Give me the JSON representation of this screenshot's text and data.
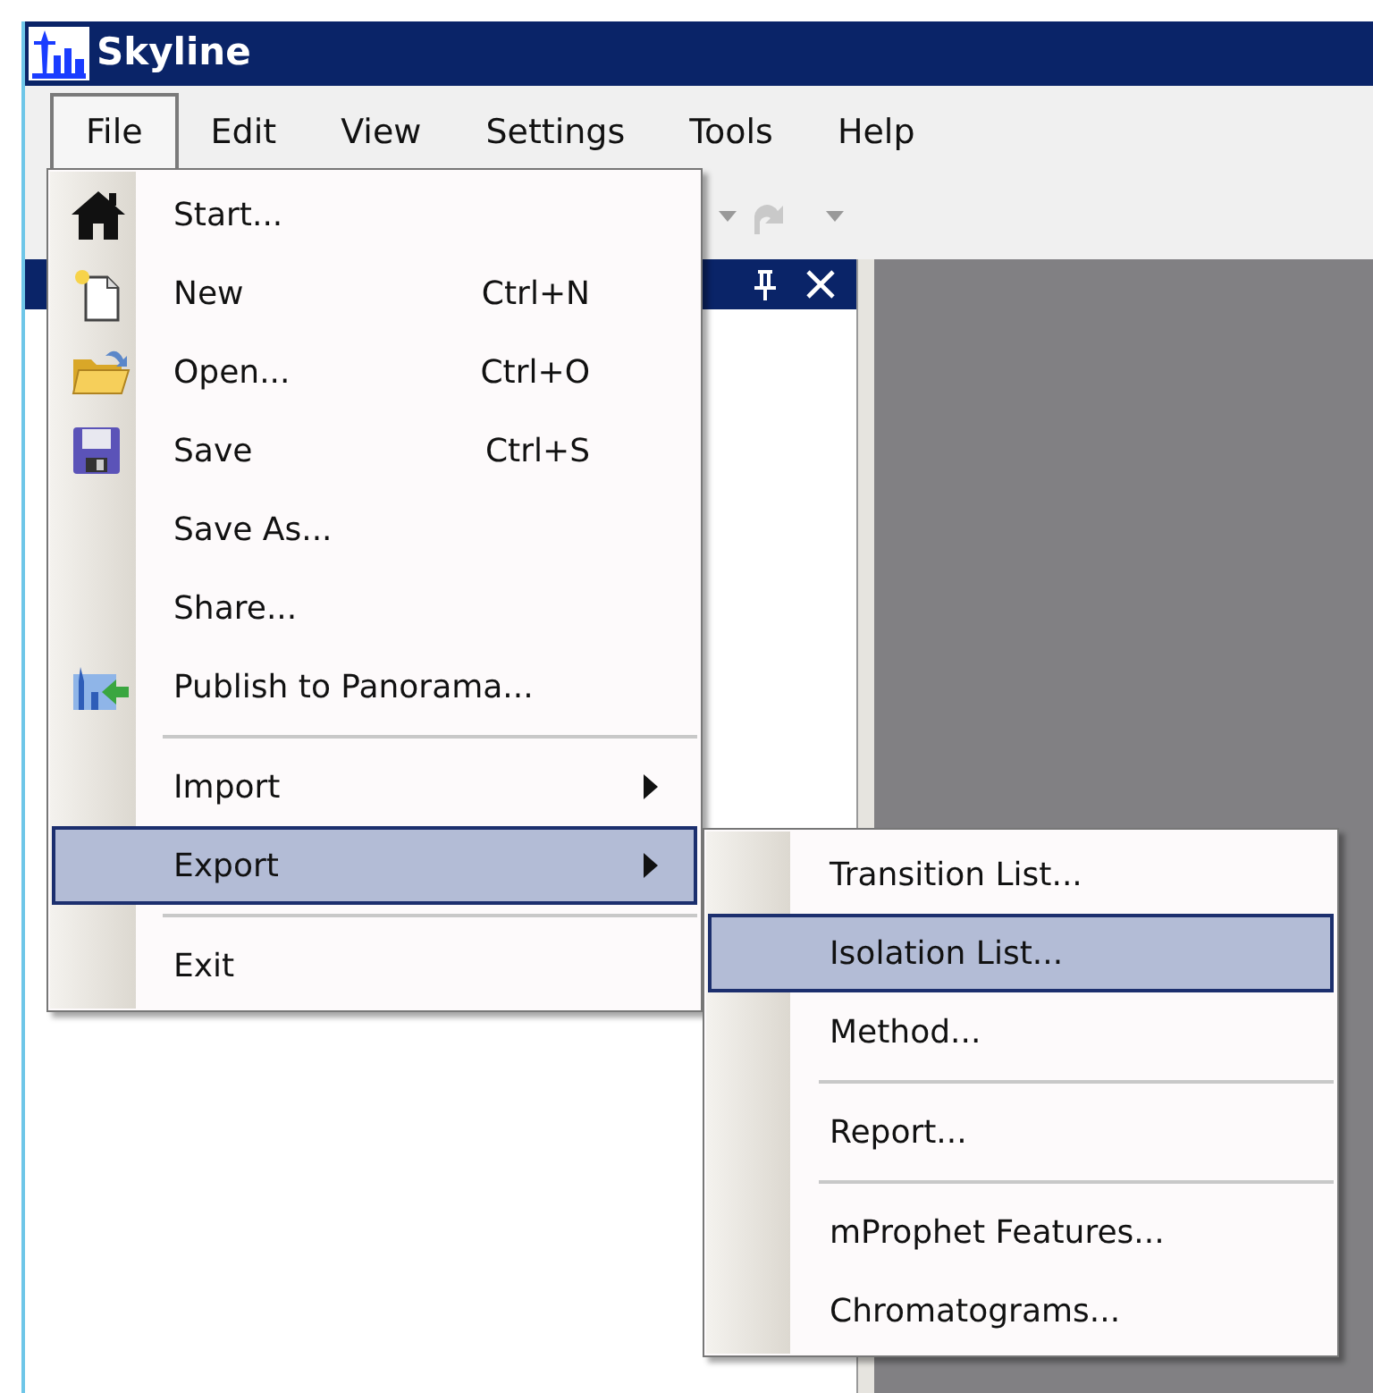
{
  "window": {
    "title": "Skyline"
  },
  "menu_bar": [
    {
      "label": "File",
      "selected": true
    },
    {
      "label": "Edit",
      "selected": false
    },
    {
      "label": "View",
      "selected": false
    },
    {
      "label": "Settings",
      "selected": false
    },
    {
      "label": "Tools",
      "selected": false
    },
    {
      "label": "Help",
      "selected": false
    }
  ],
  "file_menu": [
    {
      "kind": "item",
      "label": "Start...",
      "selected": false
    },
    {
      "kind": "item",
      "label": "New",
      "shortcut": "Ctrl+N",
      "selected": false
    },
    {
      "kind": "item",
      "label": "Open...",
      "shortcut": "Ctrl+O",
      "selected": false
    },
    {
      "kind": "item",
      "label": "Save",
      "shortcut": "Ctrl+S",
      "selected": false
    },
    {
      "kind": "item",
      "label": "Save As...",
      "selected": false
    },
    {
      "kind": "item",
      "label": "Share...",
      "selected": false
    },
    {
      "kind": "item",
      "label": "Publish to Panorama...",
      "selected": false
    },
    {
      "kind": "separator"
    },
    {
      "kind": "submenu",
      "label": "Import",
      "selected": false
    },
    {
      "kind": "submenu",
      "label": "Export",
      "selected": true
    },
    {
      "kind": "separator"
    },
    {
      "kind": "item",
      "label": "Exit",
      "selected": false
    }
  ],
  "export_submenu": [
    {
      "kind": "item",
      "label": "Transition List...",
      "selected": false
    },
    {
      "kind": "item",
      "label": "Isolation List...",
      "selected": true
    },
    {
      "kind": "item",
      "label": "Method...",
      "selected": false
    },
    {
      "kind": "separator"
    },
    {
      "kind": "item",
      "label": "Report...",
      "selected": false
    },
    {
      "kind": "separator"
    },
    {
      "kind": "item",
      "label": "mProphet Features...",
      "selected": false
    },
    {
      "kind": "item",
      "label": "Chromatograms...",
      "selected": false
    }
  ]
}
